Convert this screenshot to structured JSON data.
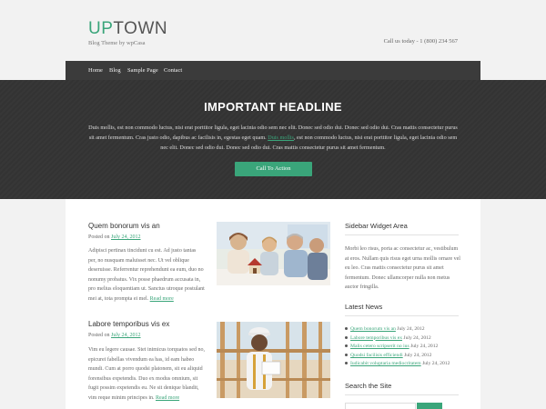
{
  "header": {
    "logo_up": "UP",
    "logo_town": "TOWN",
    "tagline": "Blog Theme by wpCasa",
    "phone": "Call us today - 1 (800) 234 567"
  },
  "nav": {
    "items": [
      {
        "label": "Home"
      },
      {
        "label": "Blog"
      },
      {
        "label": "Sample Page"
      },
      {
        "label": "Contact"
      }
    ]
  },
  "hero": {
    "title": "IMPORTANT HEADLINE",
    "text_before_link": "Duis mollis, est non commodo luctus, nisi erat porttitor ligula, eget lacinia odio sem nec elit. Donec sed odio dui. Donec sed odio dui. Cras mattis consectetur purus sit amet fermentum. Cras justo odio, dapibus ac facilisis in, egestas eget quam. ",
    "link_text": "Duis mollis",
    "text_after_link": ", est non commodo luctus, nisi erat porttitor ligula, eget lacinia odio sem nec elit. Donec sed odio dui. Donec sed odio dui. Cras mattis consectetur purus sit amet fermentum.",
    "cta_label": "Call To Action"
  },
  "posts": [
    {
      "title": "Quem bonorum vis an",
      "posted_on": "Posted on ",
      "date": "July 24, 2012",
      "excerpt": "Adipisci pertinax tincidunt cu est. Ad justo tantas per, no nusquam maluisset nec. Ut vel oblique deseruisse. Referrentur reprehendunt ea eum, duo no nonumy probatus. Vix posse phaedrum accusata in, pro melius eloquentiam ut. Sanctus utroque postulant mei at, tota prompta ei mel. ",
      "read_more": "Read more"
    },
    {
      "title": "Labore temporibus vis ex",
      "posted_on": "Posted on ",
      "date": "July 24, 2012",
      "excerpt": "Vim eu legere causae. Stet inimicus torquatos sed no, epicurei fabellas vivendum ea has, id eam habeo mundi. Cum at porro quodsi platonem, sit eu aliquid forensibus expetendis. Duo ex modus omnium, sit fugit possim expetendis eu. Ne sit denique blandit, vim reque minim principes in. ",
      "read_more": "Read more"
    }
  ],
  "sidebar": {
    "widget_title": "Sidebar Widget Area",
    "widget_text": "Morbi leo risus, porta ac consectetur ac, vestibulum at eros. Nullam quis risus eget urna mollis ornare vel eu leo. Cras mattis consectetur purus sit amet fermentum. Donec ullamcorper nulla non metus auctor fringilla.",
    "news_title": "Latest News",
    "news": [
      {
        "link": "Quem bonorum vis an",
        "date": " July 24, 2012"
      },
      {
        "link": "Labore temporibus vis ex",
        "date": " July 24, 2012"
      },
      {
        "link": "Malis cetero scripserit no ius",
        "date": " July 24, 2012"
      },
      {
        "link": "Quodsi facilisis efficiendi",
        "date": " July 24, 2012"
      },
      {
        "link": "Iudicabit voluptaria mediocritatem",
        "date": " July 24, 2012"
      }
    ],
    "search_title": "Search the Site"
  },
  "colors": {
    "accent": "#3aa57a",
    "nav_bg": "#3b3b3b",
    "hero_bg": "#333333"
  }
}
